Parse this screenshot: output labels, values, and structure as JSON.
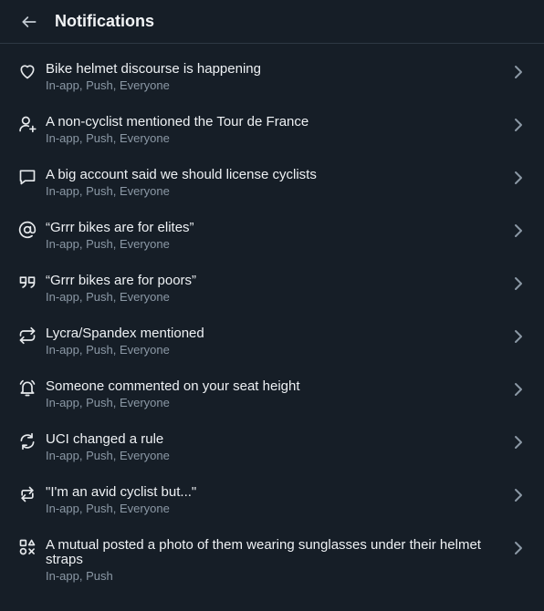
{
  "header": {
    "title": "Notifications"
  },
  "items": [
    {
      "label": "Bike helmet discourse is happening",
      "sub": "In-app, Push, Everyone",
      "icon": "heart-icon"
    },
    {
      "label": "A non-cyclist mentioned the Tour de France",
      "sub": "In-app, Push, Everyone",
      "icon": "user-plus-icon"
    },
    {
      "label": "A big account said we should license cyclists",
      "sub": "In-app, Push, Everyone",
      "icon": "message-icon"
    },
    {
      "label": "“Grrr bikes are for elites”",
      "sub": "In-app, Push, Everyone",
      "icon": "at-icon"
    },
    {
      "label": "“Grrr bikes are for poors”",
      "sub": "In-app, Push, Everyone",
      "icon": "quote-icon"
    },
    {
      "label": "Lycra/Spandex mentioned",
      "sub": "In-app, Push, Everyone",
      "icon": "repost-icon"
    },
    {
      "label": "Someone commented on your seat height",
      "sub": "In-app, Push, Everyone",
      "icon": "bell-icon"
    },
    {
      "label": "UCI changed a rule",
      "sub": "In-app, Push, Everyone",
      "icon": "refresh-icon"
    },
    {
      "label": "\"I'm an avid cyclist but...\"",
      "sub": "In-app, Push, Everyone",
      "icon": "swap-icon"
    },
    {
      "label": "A mutual posted a photo of them wearing sunglasses under their helmet straps",
      "sub": "In-app, Push",
      "icon": "shapes-icon"
    }
  ]
}
